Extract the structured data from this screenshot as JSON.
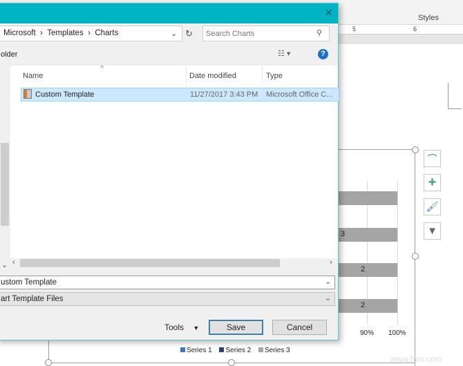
{
  "word": {
    "styles_label": "Styles",
    "ruler_marks": [
      "5",
      "6"
    ],
    "chart": {
      "type": "bar",
      "bar_labels": [
        "",
        "3",
        "2",
        "2"
      ],
      "axis_ticks": [
        "90%",
        "100%"
      ],
      "legend": [
        {
          "name": "Series 1",
          "color": "#4472c4"
        },
        {
          "name": "Series 2",
          "color": "#264478"
        },
        {
          "name": "Series 3",
          "color": "#a5a5a5"
        }
      ]
    },
    "side_buttons": [
      "layout-options-icon",
      "chart-elements-icon",
      "chart-styles-icon",
      "chart-filters-icon"
    ],
    "watermark": "www.fam.com"
  },
  "dialog": {
    "close": "✕",
    "breadcrumb": [
      "Microsoft",
      "Templates",
      "Charts"
    ],
    "search_placeholder": "Search Charts",
    "new_folder": "older",
    "columns": {
      "name": "Name",
      "date": "Date modified",
      "type": "Type"
    },
    "files": [
      {
        "name": "Custom Template",
        "date": "11/27/2017 3:43 PM",
        "type": "Microsoft Office C..."
      }
    ],
    "file_name": "ustom Template",
    "file_type": "art Template Files",
    "tools": "Tools",
    "save": "Save",
    "cancel": "Cancel",
    "accent": "#00b4c4"
  }
}
